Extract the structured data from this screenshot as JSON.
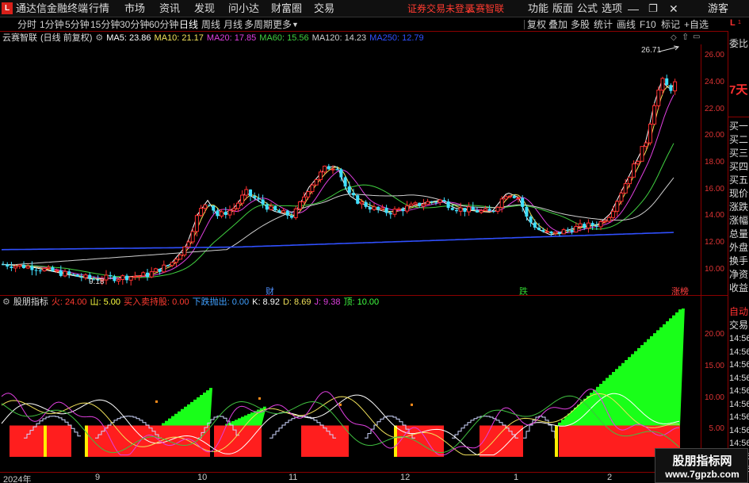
{
  "titlebar": {
    "logo": "L",
    "app_title": "通达信金融终端",
    "menus": [
      "行情",
      "市场",
      "资讯",
      "发现",
      "问小达",
      "财富圈",
      "交易"
    ],
    "notice_left": "证券交易未登录",
    "notice_right": "云赛智联",
    "right_menus": [
      "功能",
      "版面",
      "公式",
      "选项"
    ],
    "guest": "游客"
  },
  "periodbar": {
    "periods": [
      "分时",
      "1分钟",
      "5分钟",
      "15分钟",
      "30分钟",
      "60分钟",
      "日线",
      "周线",
      "月线",
      "多周期",
      "更多"
    ],
    "active": "日线",
    "tools": [
      "复权",
      "叠加",
      "多股",
      "统计",
      "画线",
      "F10",
      "标记",
      "+自选"
    ]
  },
  "main_chart": {
    "stock": "云赛智联",
    "mode": "(日线 前复权)",
    "ma": [
      {
        "label": "MA5: 23.86",
        "color": "#ffffff"
      },
      {
        "label": "MA10: 21.17",
        "color": "#f0e05a"
      },
      {
        "label": "MA20: 17.85",
        "color": "#e040e0"
      },
      {
        "label": "MA60: 15.56",
        "color": "#40d040"
      },
      {
        "label": "MA120: 14.23",
        "color": "#d0d0d0"
      },
      {
        "label": "MA250: 12.79",
        "color": "#3050ff"
      }
    ],
    "high_marker": "26.71",
    "low_marker": "9.18",
    "event_labels": [
      {
        "text": "财",
        "color": "#5090ff"
      },
      {
        "text": "跌",
        "color": "#30d030"
      },
      {
        "text": "涨榜",
        "color": "#ff4040"
      }
    ],
    "y_ticks": [
      "26.00",
      "24.00",
      "22.00",
      "20.00",
      "18.00",
      "16.00",
      "14.00",
      "12.00",
      "10.00"
    ]
  },
  "indicator": {
    "name": "股朋指标",
    "values": [
      {
        "label": "火: 24.00",
        "color": "#ff3b30"
      },
      {
        "label": "山: 5.00",
        "color": "#ffff40"
      },
      {
        "label": "买入卖持股: 0.00",
        "color": "#ff3b30"
      },
      {
        "label": "下跌抛出: 0.00",
        "color": "#40a0ff"
      },
      {
        "label": "K: 8.92",
        "color": "#ffffff"
      },
      {
        "label": "D: 8.69",
        "color": "#f0e05a"
      },
      {
        "label": "J: 9.38",
        "color": "#e040e0"
      },
      {
        "label": "顶: 10.00",
        "color": "#40ff40"
      }
    ],
    "y_ticks": [
      "20.00",
      "15.00",
      "10.00",
      "5.00"
    ]
  },
  "date_axis": [
    "2024年",
    "9",
    "10",
    "11",
    "12",
    "1",
    "2"
  ],
  "right_panel": {
    "top": [
      "委比",
      "7天"
    ],
    "items": [
      "买一",
      "买二",
      "买三",
      "买四",
      "买五",
      "现价",
      "涨跌",
      "涨幅",
      "总量",
      "外盘",
      "换手",
      "净资",
      "收益"
    ],
    "mode": [
      "自动",
      "交易"
    ],
    "times": [
      "14:56",
      "14:56",
      "14:56",
      "14:56",
      "14:56",
      "14:56",
      "14:56",
      "14:56",
      "14:56",
      "14:56",
      "14:56"
    ]
  },
  "watermark": {
    "title": "股朋指标网",
    "url": "www.7gpzb.com"
  },
  "colors": {
    "up": "#ff3030",
    "down": "#40e0ff",
    "accent": "#d8201a"
  }
}
